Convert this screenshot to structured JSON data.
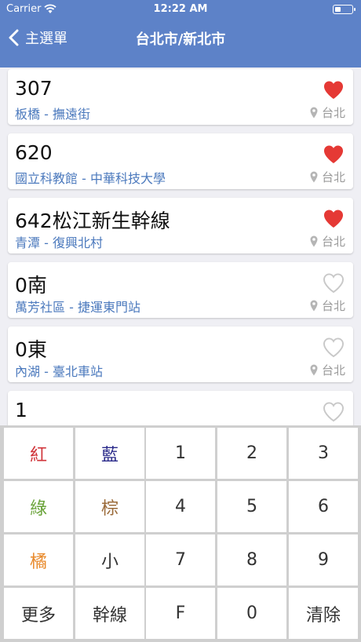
{
  "status_bar": {
    "carrier": "Carrier",
    "time": "12:22 AM",
    "battery_level": 0.35
  },
  "nav": {
    "back_label": "主選單",
    "title": "台北市/新北市"
  },
  "colors": {
    "header": "#5d82c8",
    "link": "#4b79bd",
    "heart_on": "#e53935",
    "heart_off": "#c8c8c8"
  },
  "routes": [
    {
      "number": "307",
      "stops": "板橋 - 撫遠街",
      "city": "台北",
      "favorite": true
    },
    {
      "number": "620",
      "stops": "國立科教館 - 中華科技大學",
      "city": "台北",
      "favorite": true
    },
    {
      "number": "642松江新生幹線",
      "stops": "青潭 - 復興北村",
      "city": "台北",
      "favorite": true
    },
    {
      "number": "0南",
      "stops": "萬芳社區 - 捷運東門站",
      "city": "台北",
      "favorite": false
    },
    {
      "number": "0東",
      "stops": "內湖 - 臺北車站",
      "city": "台北",
      "favorite": false
    },
    {
      "number": "1",
      "stops": "",
      "city": "",
      "favorite": false
    }
  ],
  "keypad": [
    {
      "label": "紅",
      "color": "#d0343a"
    },
    {
      "label": "藍",
      "color": "#2a2a8a"
    },
    {
      "label": "1",
      "color": "#333333"
    },
    {
      "label": "2",
      "color": "#333333"
    },
    {
      "label": "3",
      "color": "#333333"
    },
    {
      "label": "綠",
      "color": "#6aa33a"
    },
    {
      "label": "棕",
      "color": "#9b6b3a"
    },
    {
      "label": "4",
      "color": "#333333"
    },
    {
      "label": "5",
      "color": "#333333"
    },
    {
      "label": "6",
      "color": "#333333"
    },
    {
      "label": "橘",
      "color": "#e8892a"
    },
    {
      "label": "小",
      "color": "#333333"
    },
    {
      "label": "7",
      "color": "#333333"
    },
    {
      "label": "8",
      "color": "#333333"
    },
    {
      "label": "9",
      "color": "#333333"
    },
    {
      "label": "更多",
      "color": "#333333"
    },
    {
      "label": "幹線",
      "color": "#333333"
    },
    {
      "label": "F",
      "color": "#333333"
    },
    {
      "label": "0",
      "color": "#333333"
    },
    {
      "label": "清除",
      "color": "#333333"
    }
  ]
}
